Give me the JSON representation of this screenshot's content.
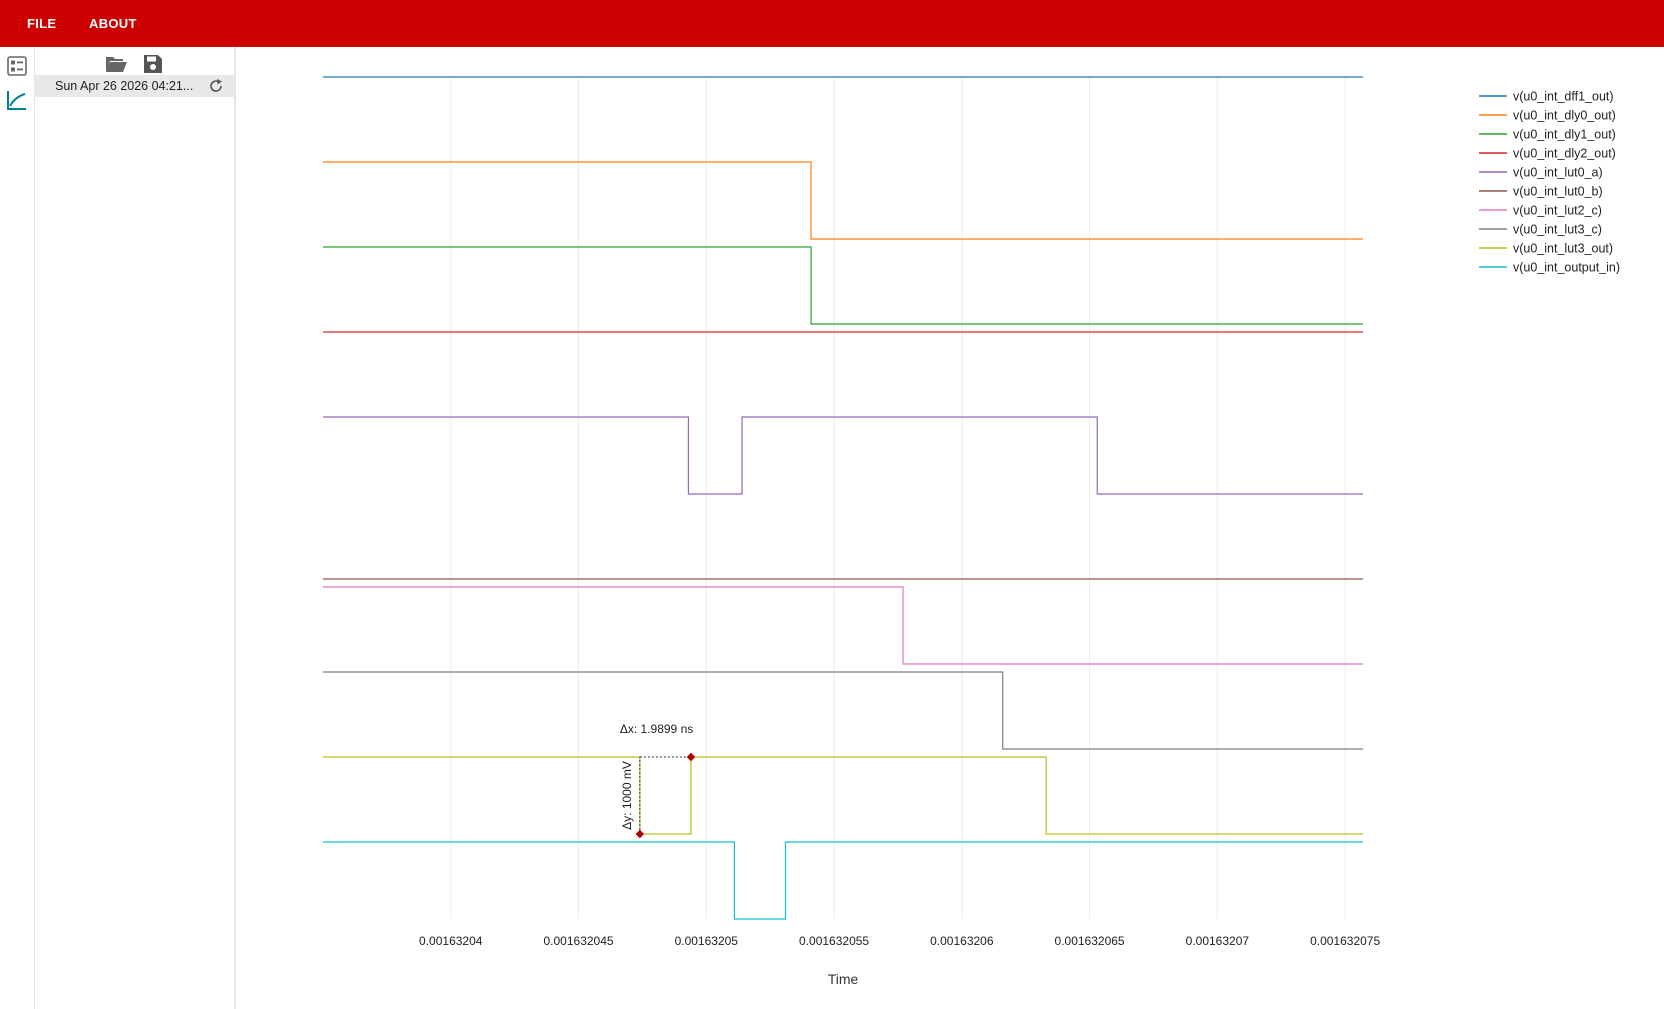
{
  "menu": {
    "file": "FILE",
    "about": "ABOUT"
  },
  "sidebar": {
    "file_label": "Sun Apr 26 2026 04:21...",
    "toolbar": {
      "open": "folder-open-icon",
      "save": "save-icon"
    },
    "strip": [
      "list-icon",
      "chart-line-icon"
    ]
  },
  "colors": {
    "topbar": "#cc0000",
    "accent": "#00838f"
  },
  "chart_data": {
    "type": "line",
    "xlabel": "Time",
    "ylabel": "",
    "xlim": [
      0.001632035,
      0.0016320757
    ],
    "x_ticks": [
      "0.00163204",
      "0.001632045",
      "0.00163205",
      "0.001632055",
      "0.00163206",
      "0.001632065",
      "0.00163207",
      "0.001632075"
    ],
    "x_tick_values": [
      0.00163204,
      0.001632045,
      0.00163205,
      0.001632055,
      0.00163206,
      0.001632065,
      0.00163207,
      0.001632075
    ],
    "grid": true,
    "legend_position": "right",
    "lane_top_ms": 1009,
    "series": [
      {
        "name": "v(u0_int_dff1_out)",
        "color": "#1f77b4",
        "steps": [
          [
            0.001632035,
            1
          ],
          [
            0.0016320757,
            1
          ]
        ]
      },
      {
        "name": "v(u0_int_dly0_out)",
        "color": "#ff7f0e",
        "steps": [
          [
            0.001632035,
            1
          ],
          [
            0.0016320541,
            0
          ],
          [
            0.0016320757,
            0
          ]
        ]
      },
      {
        "name": "v(u0_int_dly1_out)",
        "color": "#2ca02c",
        "steps": [
          [
            0.001632035,
            1
          ],
          [
            0.0016320541,
            0
          ],
          [
            0.0016320757,
            0
          ]
        ]
      },
      {
        "name": "v(u0_int_dly2_out)",
        "color": "#d62728",
        "steps": [
          [
            0.001632035,
            1
          ],
          [
            0.0016320757,
            1
          ]
        ]
      },
      {
        "name": "v(u0_int_lut0_a)",
        "color": "#9467bd",
        "steps": [
          [
            0.001632035,
            1
          ],
          [
            0.0016320493,
            0
          ],
          [
            0.0016320514,
            1
          ],
          [
            0.0016320653,
            0
          ],
          [
            0.0016320757,
            0
          ]
        ]
      },
      {
        "name": "v(u0_int_lut0_b)",
        "color": "#8c564b",
        "steps": [
          [
            0.001632035,
            0
          ],
          [
            0.0016320757,
            0
          ]
        ]
      },
      {
        "name": "v(u0_int_lut2_c)",
        "color": "#e377c2",
        "steps": [
          [
            0.001632035,
            1
          ],
          [
            0.0016320577,
            0
          ],
          [
            0.0016320757,
            0
          ]
        ]
      },
      {
        "name": "v(u0_int_lut3_c)",
        "color": "#7f7f7f",
        "steps": [
          [
            0.001632035,
            1
          ],
          [
            0.0016320616,
            0
          ],
          [
            0.0016320757,
            0
          ]
        ]
      },
      {
        "name": "v(u0_int_lut3_out)",
        "color": "#bcbd22",
        "steps": [
          [
            0.001632035,
            1
          ],
          [
            0.0016320474,
            0
          ],
          [
            0.0016320494,
            1
          ],
          [
            0.0016320633,
            0
          ],
          [
            0.0016320757,
            0
          ]
        ]
      },
      {
        "name": "v(u0_int_output_in)",
        "color": "#17becf",
        "steps": [
          [
            0.001632035,
            1
          ],
          [
            0.0016320511,
            0
          ],
          [
            0.0016320531,
            1
          ],
          [
            0.0016320757,
            1
          ]
        ]
      }
    ],
    "cursor": {
      "series": "v(u0_int_lut3_out)",
      "x1": 0.0016320474,
      "y1": 0,
      "x2": 0.0016320494,
      "y2": 1,
      "dx_label": "Δx: 1.9899 ns",
      "dy_label": "Δy: 1000 mV"
    }
  }
}
